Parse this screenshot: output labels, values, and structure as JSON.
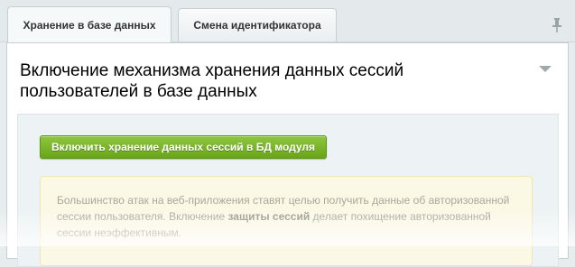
{
  "tabs": [
    {
      "label": "Хранение в базе данных",
      "active": true
    },
    {
      "label": "Смена идентификатора",
      "active": false
    }
  ],
  "pin_icon": "pin-icon",
  "section": {
    "title": "Включение механизма хранения данных сессий пользователей в базе данных",
    "collapse_icon": "triangle-down-icon"
  },
  "action": {
    "button_label": "Включить хранение данных сессий в БД модуля",
    "color": "#7ab52a"
  },
  "note": {
    "text_before": "Большинство атак на веб-приложения ставят целью получить данные об авторизованной сессии пользователя. Включение ",
    "text_bold": "защиты сессий",
    "text_after": " делает похищение авторизованной сессии неэффективным."
  }
}
